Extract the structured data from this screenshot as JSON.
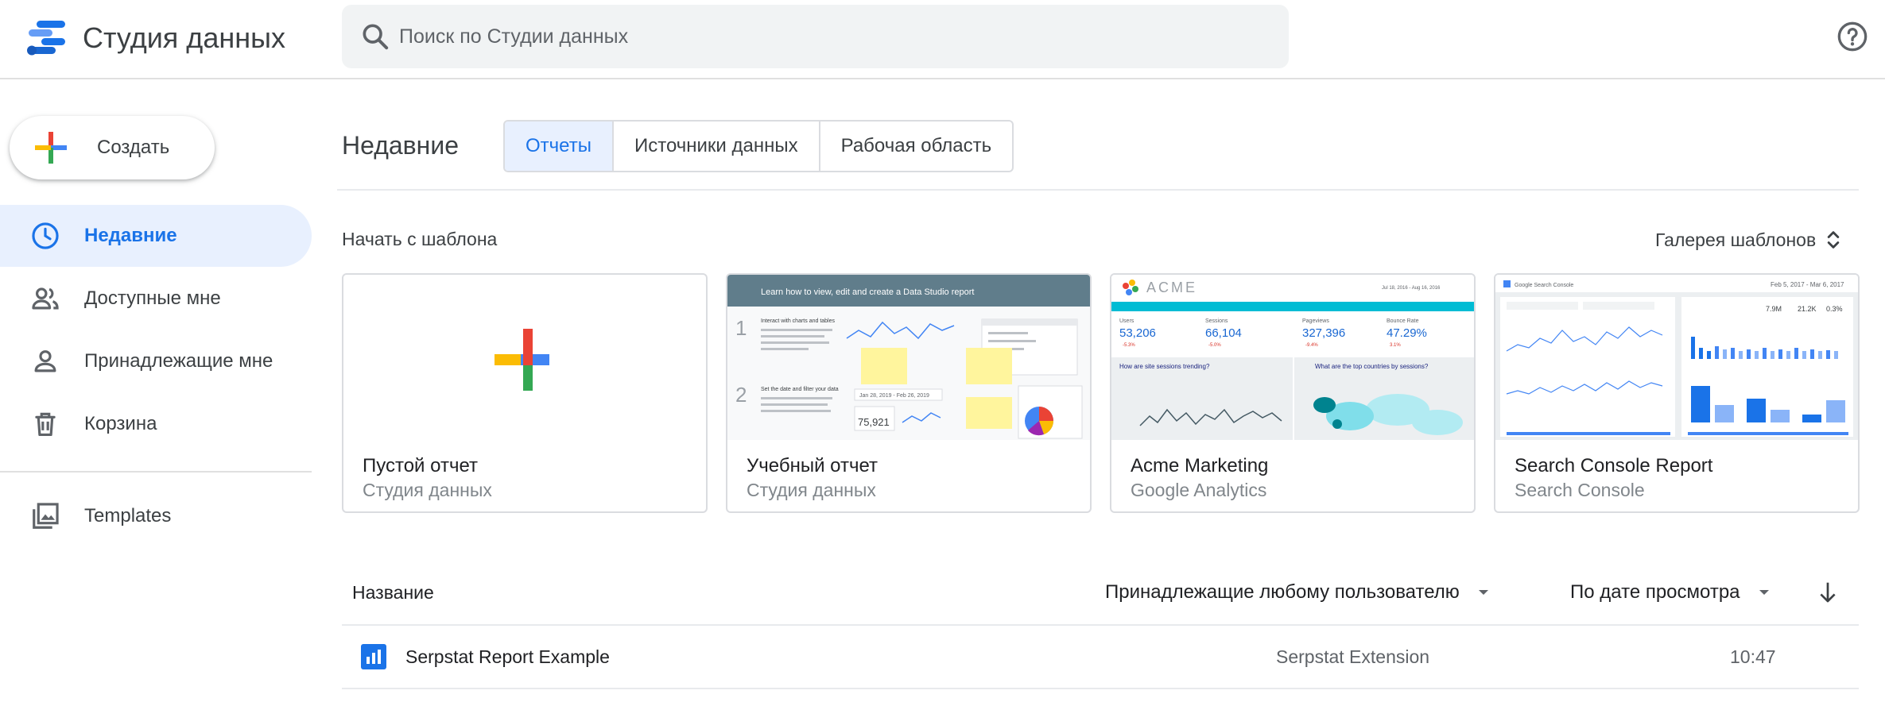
{
  "header": {
    "app_title": "Студия данных",
    "search_placeholder": "Поиск по Студии данных",
    "search_value": "",
    "icons": {
      "logo": "data-studio-logo",
      "search": "search-icon",
      "help": "help-icon"
    }
  },
  "sidebar": {
    "create_label": "Создать",
    "items": [
      {
        "label": "Недавние",
        "icon": "clock-icon",
        "active": true
      },
      {
        "label": "Доступные мне",
        "icon": "people-icon",
        "active": false
      },
      {
        "label": "Принадлежащие мне",
        "icon": "person-icon",
        "active": false
      },
      {
        "label": "Корзина",
        "icon": "trash-icon",
        "active": false
      },
      {
        "label": "Templates",
        "icon": "templates-icon",
        "active": false
      }
    ]
  },
  "main": {
    "section_title": "Недавние",
    "tabs": [
      {
        "label": "Отчеты",
        "active": true
      },
      {
        "label": "Источники данных",
        "active": false
      },
      {
        "label": "Рабочая область",
        "active": false
      }
    ],
    "templates_heading": "Начать с шаблона",
    "gallery_label": "Галерея шаблонов",
    "templates": [
      {
        "title": "Пустой отчет",
        "subtitle": "Студия данных"
      },
      {
        "title": "Учебный отчет",
        "subtitle": "Студия данных",
        "thumb": {
          "banner": "Learn how to view, edit and create a Data Studio report",
          "step1": "1",
          "step1_heading": "Interact with charts and tables",
          "step2": "2",
          "step2_heading": "Set the date and filter your data",
          "date_range": "Jan 28, 2019 - Feb 26, 2019",
          "metric": "75,921"
        }
      },
      {
        "title": "Acme Marketing",
        "subtitle": "Google Analytics",
        "thumb": {
          "brand": "ACME",
          "date_range": "Jul 18, 2016 - Aug 16, 2016",
          "kpis": [
            {
              "label": "Users",
              "value": "53,206",
              "delta": "-5.3%"
            },
            {
              "label": "Sessions",
              "value": "66,104",
              "delta": "-5.0%"
            },
            {
              "label": "Pageviews",
              "value": "327,396",
              "delta": "-9.4%"
            },
            {
              "label": "Bounce Rate",
              "value": "47.29%",
              "delta": "3.1%"
            }
          ],
          "chart1_title": "How are site sessions trending?",
          "chart2_title": "What are the top countries by sessions?"
        }
      },
      {
        "title": "Search Console Report",
        "subtitle": "Search Console",
        "thumb": {
          "brand": "Google Search Console",
          "date_range": "Feb 5, 2017 - Mar 6, 2017",
          "kpis": [
            "7.9M",
            "21.2K",
            "0.3%"
          ]
        }
      }
    ]
  },
  "table": {
    "col_name": "Название",
    "owner_filter": "Принадлежащие любому пользователю",
    "sort_filter": "По дате просмотра",
    "rows": [
      {
        "name": "Serpstat Report Example",
        "source": "Serpstat Extension",
        "time": "10:47",
        "icon": "report-icon"
      }
    ]
  },
  "colors": {
    "accent": "#1a73e8",
    "active_bg": "#e8f0fe",
    "google_red": "#ea4335",
    "google_blue": "#4285f4",
    "google_yellow": "#fbbc04",
    "google_green": "#34a853"
  }
}
